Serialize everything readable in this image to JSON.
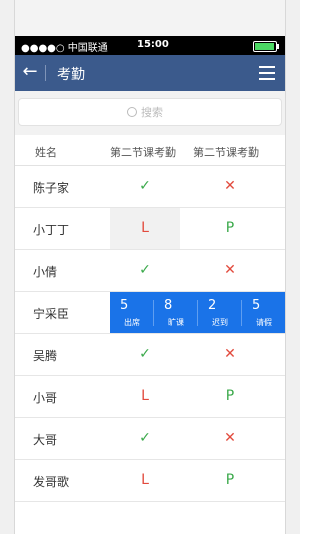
{
  "statusbar": {
    "carrier": "●●●●○ 中国联通",
    "time": "15:00"
  },
  "navbar": {
    "title": "考勤",
    "back_icon": "back-arrow-icon",
    "menu_icon": "hamburger-menu-icon"
  },
  "search": {
    "placeholder": "搜索"
  },
  "table": {
    "headers": [
      "姓名",
      "第二节课考勤",
      "第二节课考勤"
    ],
    "rows": [
      {
        "name": "陈子家",
        "a": "✓",
        "b": "✕"
      },
      {
        "name": "小丁丁",
        "a": "L",
        "b": "P"
      },
      {
        "name": "小倩",
        "a": "✓",
        "b": "✕"
      },
      {
        "name": "宁采臣",
        "a": "",
        "b": ""
      },
      {
        "name": "吴腾",
        "a": "✓",
        "b": "✕"
      },
      {
        "name": "小哥",
        "a": "L",
        "b": "P"
      },
      {
        "name": "大哥",
        "a": "✓",
        "b": "✕"
      },
      {
        "name": "发哥歌",
        "a": "L",
        "b": "P"
      }
    ]
  },
  "summary": [
    {
      "value": "5",
      "label": "出席"
    },
    {
      "value": "8",
      "label": "旷课"
    },
    {
      "value": "2",
      "label": "迟到"
    },
    {
      "value": "5",
      "label": "请假"
    }
  ],
  "colors": {
    "navbar": "#3b5a8c",
    "summary": "#1a73e8",
    "check": "#3aa94a",
    "cross": "#e24a3d"
  }
}
